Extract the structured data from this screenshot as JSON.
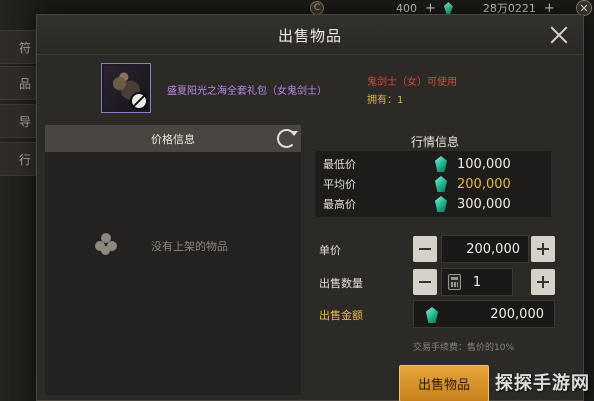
{
  "background": {
    "side_tabs": [
      "符",
      "品",
      "导",
      "行"
    ],
    "currency_a_value": "400",
    "currency_b_value": "28万0221",
    "plus_label": "+"
  },
  "dialog": {
    "title": "出售物品",
    "item": {
      "name": "盛夏阳光之海全套礼包（女鬼剑士）",
      "restriction": "鬼剑士（女）可使用",
      "owned": "拥有：1",
      "rarity_color": "#b88be8"
    },
    "left_panel": {
      "header": "价格信息",
      "empty_text": "没有上架的物品"
    },
    "market": {
      "title": "行情信息",
      "rows": [
        {
          "label": "最低价",
          "value": "100,000",
          "color": "#f0ece2"
        },
        {
          "label": "平均价",
          "value": "200,000",
          "color": "#e8b84b"
        },
        {
          "label": "最高价",
          "value": "300,000",
          "color": "#f0ece2"
        }
      ]
    },
    "form": {
      "unit_price_label": "单价",
      "unit_price_value": "200,000",
      "quantity_label": "出售数量",
      "quantity_value": "1",
      "total_label": "出售金额",
      "total_value": "200,000"
    },
    "fee_note": "交易手续费：售价的10%",
    "sell_button": "出售物品"
  },
  "watermark": "探探手游网",
  "colors": {
    "accent_button": "#d9922c",
    "total_label": "#e8b84b"
  }
}
